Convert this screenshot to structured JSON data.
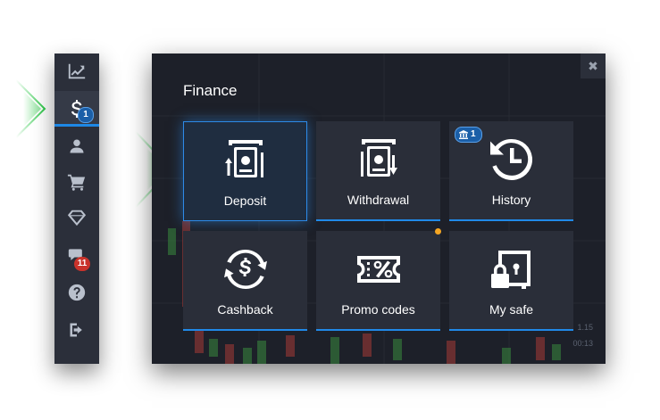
{
  "sidebar": {
    "items": [
      {
        "name": "trading",
        "icon": "chart-line-icon"
      },
      {
        "name": "finance",
        "icon": "dollar-icon",
        "badge": "1",
        "active": true
      },
      {
        "name": "profile",
        "icon": "user-icon"
      },
      {
        "name": "market",
        "icon": "cart-icon"
      },
      {
        "name": "achievements",
        "icon": "diamond-icon"
      },
      {
        "name": "chat",
        "icon": "chat-icon",
        "badge": "11"
      },
      {
        "name": "help",
        "icon": "help-icon"
      },
      {
        "name": "logout",
        "icon": "logout-icon"
      }
    ]
  },
  "panel": {
    "title": "Finance",
    "close_glyph": "✖",
    "price_labels": [
      "1.15",
      "00:13"
    ]
  },
  "tiles": [
    {
      "label": "Deposit",
      "icon": "atm-deposit-icon",
      "selected": true
    },
    {
      "label": "Withdrawal",
      "icon": "atm-withdraw-icon"
    },
    {
      "label": "History",
      "icon": "history-icon",
      "badge": "1",
      "badge_icon": "bank-icon"
    },
    {
      "label": "Cashback",
      "icon": "cashback-icon"
    },
    {
      "label": "Promo codes",
      "icon": "promo-coupon-icon",
      "dot": true
    },
    {
      "label": "My safe",
      "icon": "safe-icon"
    }
  ],
  "colors": {
    "accent": "#2089e8",
    "arrow": "#2fc84a",
    "badge_red": "#c9332b",
    "dot": "#f5a623"
  }
}
